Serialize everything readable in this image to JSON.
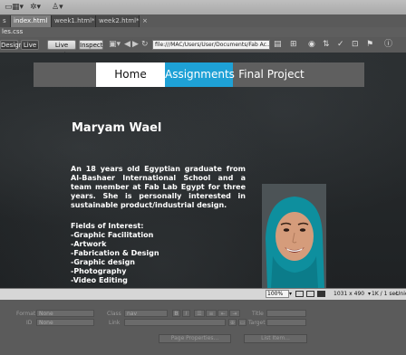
{
  "toolbar": {
    "icons": [
      "page-icon",
      "layout-icon",
      "gear-icon",
      "user-icon"
    ],
    "layout_glyph": "▦▾",
    "gear_glyph": "✲▾",
    "user_glyph": "♙▾"
  },
  "tabs": [
    {
      "label": "s",
      "active": false
    },
    {
      "label": "index.html",
      "active": true
    },
    {
      "label": "week1.html*",
      "active": false
    },
    {
      "label": "week2.html*",
      "active": false
    },
    {
      "label": "×",
      "active": false
    }
  ],
  "related_files": "les.css",
  "doc_toolbar": {
    "design_label": "Design",
    "live_label": "Live",
    "live_code_label": "Live Code",
    "inspect_label": "Inspect",
    "url": "file:///MAC/Users/User/Documents/Fab Ac..."
  },
  "page": {
    "nav": [
      "Home",
      "Assignments",
      "Final Project"
    ],
    "name": "Maryam Wael",
    "bio": "An 18 years old Egyptian graduate from Al-Bashaer International School and a team member at Fab Lab Egypt for three years. She is personally interested in sustainable product/industrial design.",
    "interests_title": "Fields of Interest:",
    "interests": [
      "-Graphic Facilitation",
      "-Artwork",
      "-Fabrication & Design",
      "-Graphic design",
      "-Photography",
      "-Video Editing"
    ]
  },
  "status": {
    "zoom": "100%",
    "dimensions": "1031 x 490",
    "size": "1K / 1 sec",
    "encoding": "Unic"
  },
  "properties": {
    "format_label": "Format",
    "format_value": "None",
    "class_label": "Class",
    "class_value": "nav",
    "id_label": "ID",
    "id_value": "None",
    "link_label": "Link",
    "title_label": "Title",
    "target_label": "Target",
    "bold_label": "B",
    "italic_label": "I",
    "page_props_label": "Page Properties...",
    "list_item_label": "List Item..."
  },
  "colors": {
    "accent": "#1ea1d6",
    "nav_bg": "#5f5f5f"
  }
}
